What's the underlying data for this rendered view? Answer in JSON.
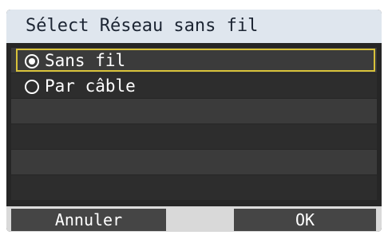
{
  "dialog": {
    "title": "Sélect Réseau sans fil",
    "options": [
      {
        "label": "Sans fil",
        "selected": true,
        "icon": "radio-selected-icon"
      },
      {
        "label": "Par câble",
        "selected": false,
        "icon": "radio-unselected-icon"
      }
    ],
    "buttons": {
      "cancel_label": "Annuler",
      "ok_label": "OK"
    }
  },
  "colors": {
    "title_bar": "#dfe6ee",
    "screen_bg": "#262626",
    "selection_border": "#d8c23a",
    "button_bg": "#454545"
  }
}
